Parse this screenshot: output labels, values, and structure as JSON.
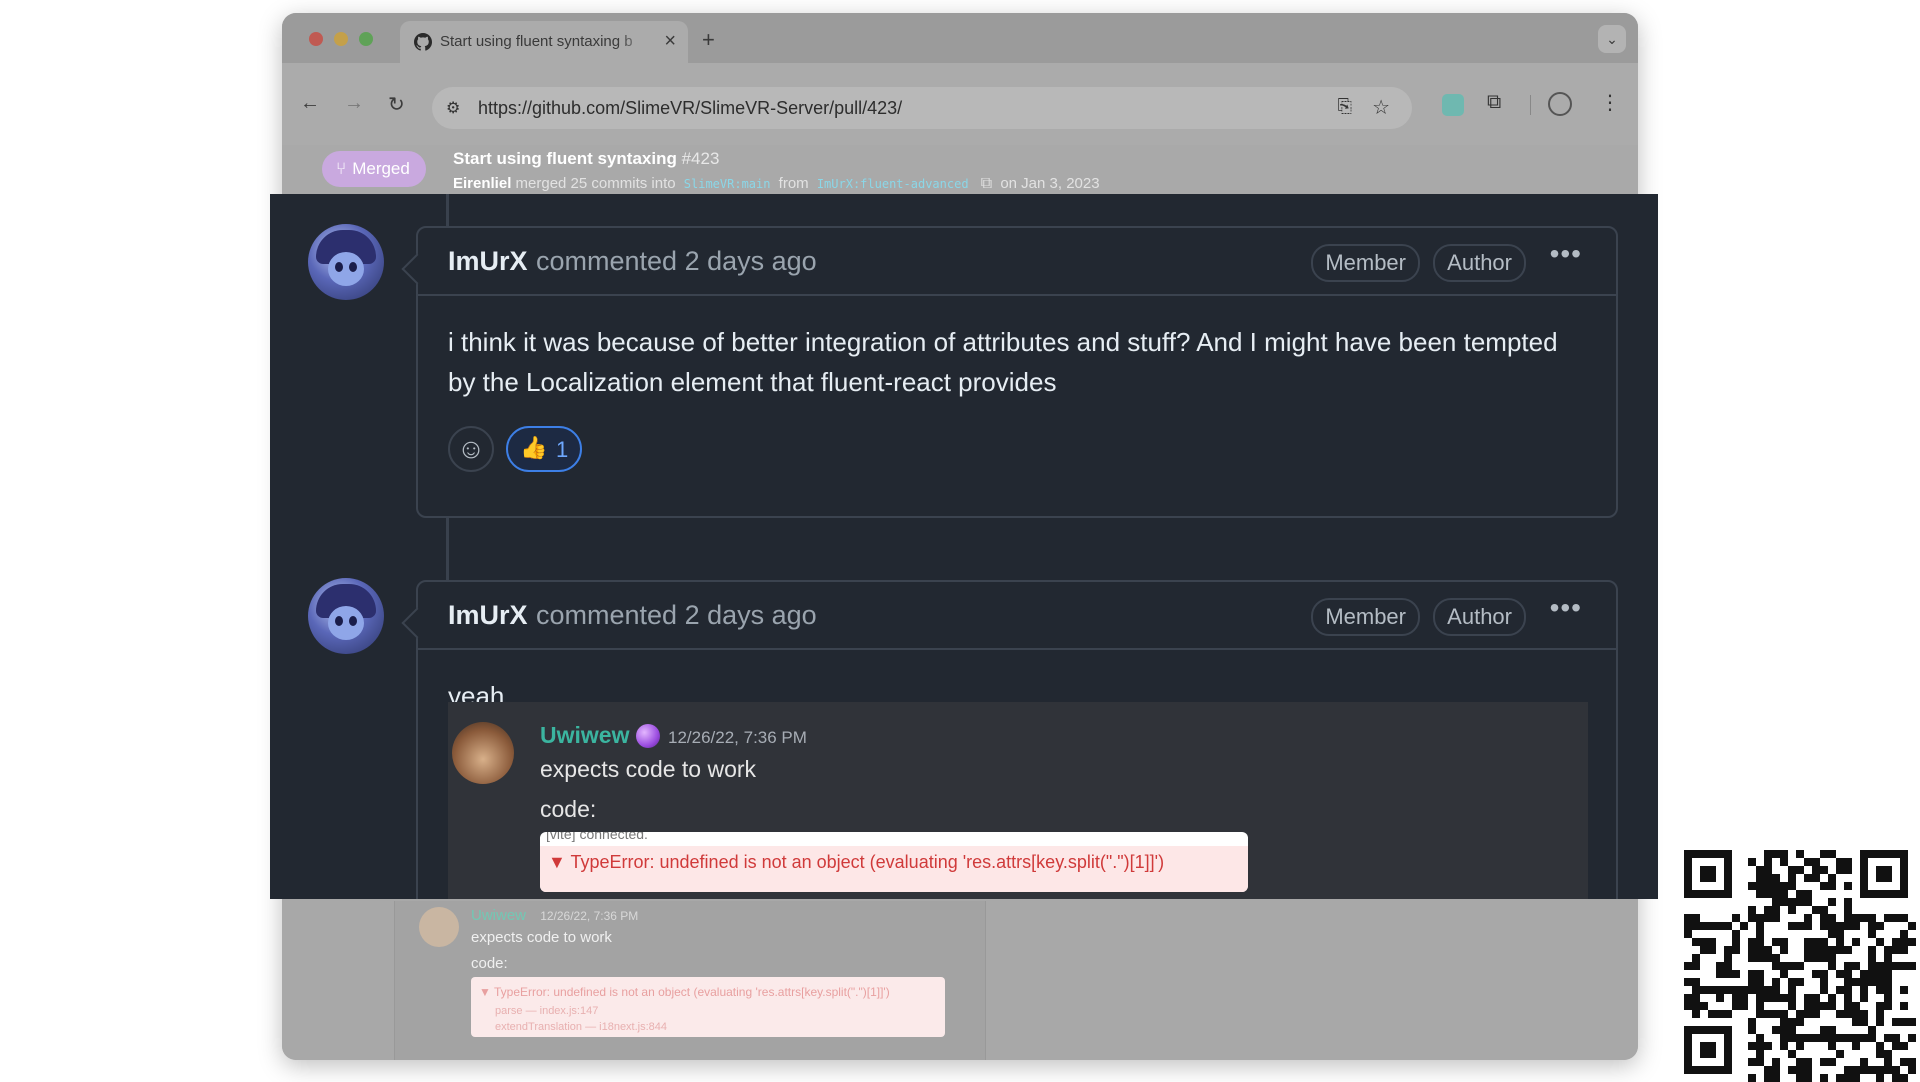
{
  "browser": {
    "tab": {
      "title": "Start using fluent syntaxing b",
      "close": "×",
      "icon": "github-icon"
    },
    "new_tab": "+",
    "tab_list": "⌄",
    "nav": {
      "back": "←",
      "forward": "→",
      "reload": "↻"
    },
    "url": "https://github.com/SlimeVR/SlimeVR-Server/pull/423/",
    "menu": "⋮"
  },
  "pr": {
    "status": "Merged",
    "title": "Start using fluent syntaxing",
    "number": "#423",
    "merged_by": "Eirenliel",
    "merge_text": "merged 25 commits into",
    "base_branch": "SlimeVR:main",
    "from_text": "from",
    "head_branch": "ImUrX:fluent-advanced",
    "date": "on Jan 3, 2023"
  },
  "comments": [
    {
      "author": "ImUrX",
      "action": "commented 2 days ago",
      "badges": [
        "Member",
        "Author"
      ],
      "more": "•••",
      "body": "i think it was because of better integration of attributes and stuff? And I might have been tempted by the Localization element that fluent-react provides",
      "reaction": {
        "emoji": "👍",
        "count": "1"
      }
    },
    {
      "author": "ImUrX",
      "action": "commented 2 days ago",
      "badges": [
        "Member",
        "Author"
      ],
      "more": "•••",
      "body": "yeah..."
    }
  ],
  "discord": {
    "username": "Uwiwew",
    "timestamp": "12/26/22, 7:36 PM",
    "line1": "expects code to work",
    "line2": "code:",
    "console_prev": "[vite] connected.",
    "error": "▼ TypeError: undefined is not an object (evaluating 'res.attrs[key.split(\".\")[1]]')"
  },
  "discord_small": {
    "username": "Uwiwew",
    "timestamp": "12/26/22, 7:36 PM",
    "line1": "expects code to work",
    "line2": "code:",
    "error": "▼ TypeError: undefined is not an object (evaluating 'res.attrs[key.split(\".\")[1]]')",
    "frame1": "parse — index.js:147",
    "frame2": "extendTranslation — i18next.js:844"
  },
  "colors": {
    "overlay_bg": "#222831",
    "merged_badge": "#c9a9df",
    "reaction_border": "#3d7fe6",
    "discord_username": "#3bb5a0"
  }
}
